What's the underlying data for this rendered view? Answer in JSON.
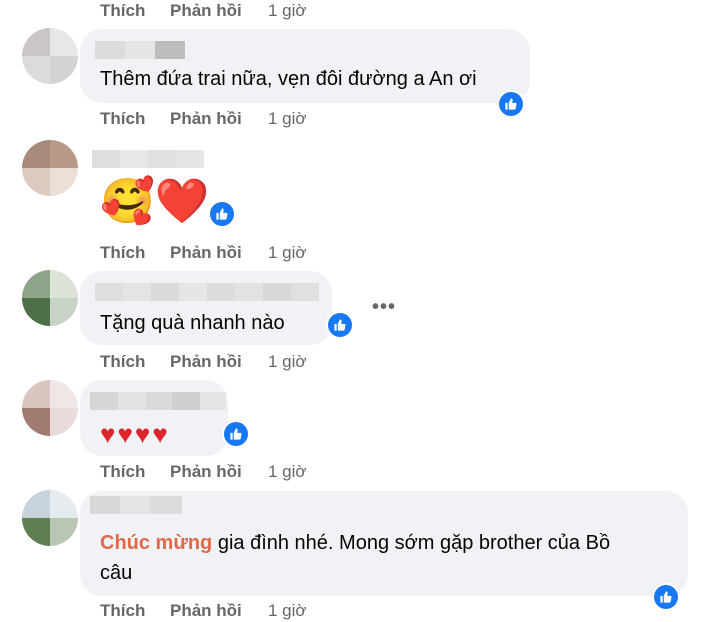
{
  "actions": {
    "like": "Thích",
    "reply": "Phản hồi",
    "time": "1 giờ"
  },
  "comments": [
    {
      "text": "Thêm đứa trai nữa, vẹn đôi đường a An ơi"
    },
    {
      "emoji": "🥰❤️"
    },
    {
      "text": "Tặng quà nhanh nào"
    },
    {
      "emoji": "♥♥♥♥"
    },
    {
      "highlight": "Chúc mừng",
      "text_line1": " gia đình nhé. Mong sớm gặp brother của Bồ",
      "text_line2": "câu"
    }
  ],
  "more_icon": "more-horizontal-icon",
  "colors": {
    "bubble": "#f0f2f5",
    "secondary_text": "#65676b",
    "like_blue": "#1877f2",
    "highlight": "#e0684b"
  }
}
